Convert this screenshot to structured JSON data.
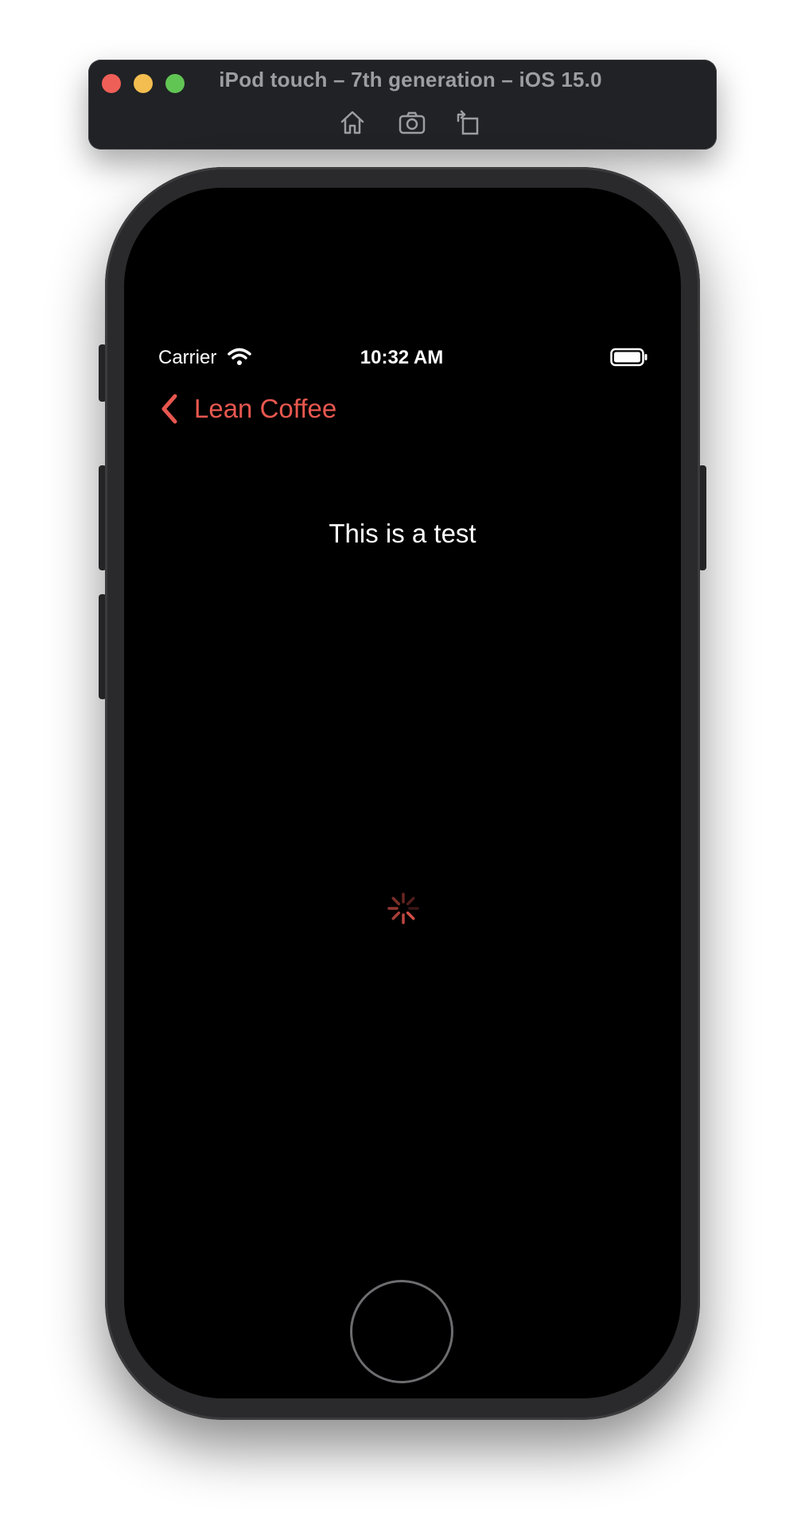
{
  "simulator": {
    "title": "iPod touch – 7th generation – iOS 15.0",
    "toolbar": {
      "home_icon": "home-icon",
      "screenshot_icon": "camera-icon",
      "rotate_icon": "rotate-icon"
    }
  },
  "status_bar": {
    "carrier": "Carrier",
    "time": "10:32 AM",
    "wifi_icon": "wifi-icon",
    "battery_icon": "battery-icon"
  },
  "nav": {
    "back_label": "Lean Coffee",
    "accent_color": "#e8574f"
  },
  "main": {
    "text": "This is a test",
    "spinner": "activity-indicator"
  },
  "colors": {
    "background": "#000000",
    "accent": "#e8574f",
    "device_frame": "#2a2a2c",
    "simulator_chrome": "#202225"
  }
}
